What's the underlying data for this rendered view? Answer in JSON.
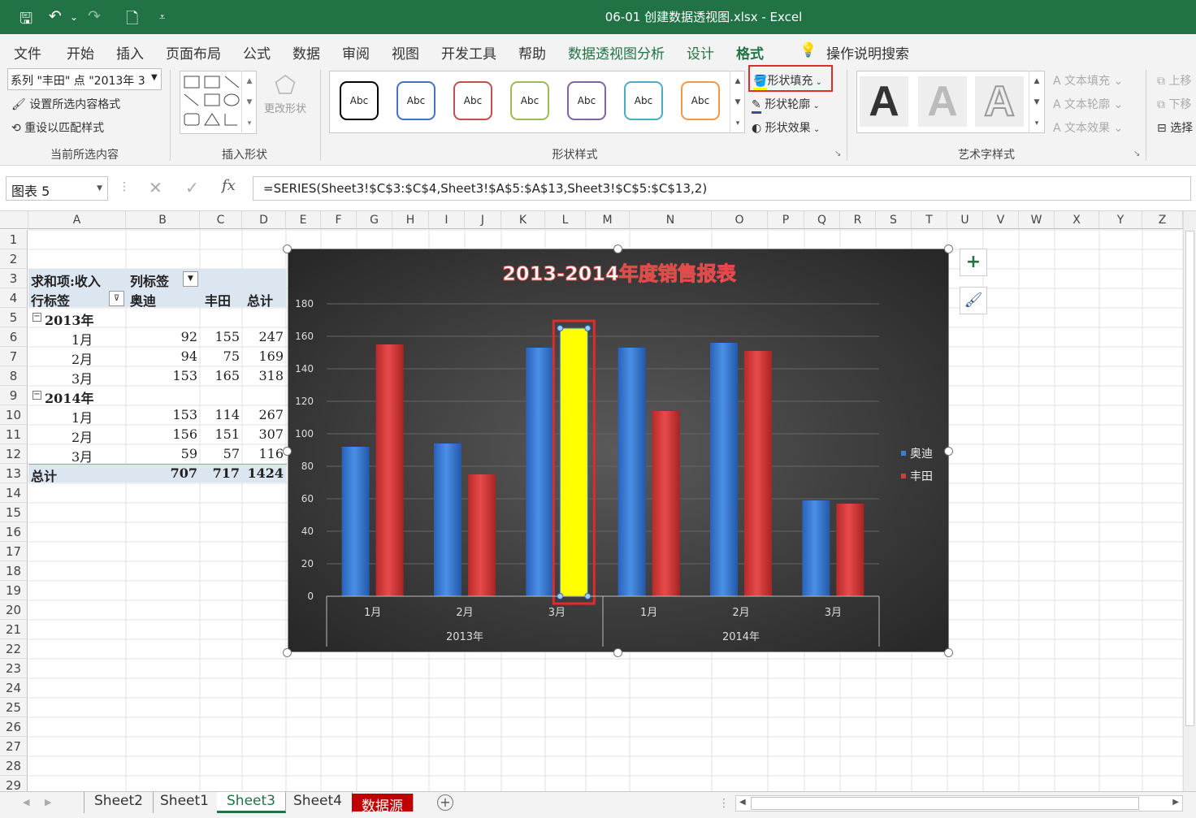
{
  "titlebar": {
    "title": "06-01 创建数据透视图.xlsx  -  Excel",
    "save_icon": "save-icon",
    "undo_icon": "undo-icon",
    "redo_icon": "redo-icon"
  },
  "tabs": [
    "文件",
    "开始",
    "插入",
    "页面布局",
    "公式",
    "数据",
    "审阅",
    "视图",
    "开发工具",
    "帮助",
    "数据透视图分析",
    "设计",
    "格式"
  ],
  "tell_me": "操作说明搜索",
  "ribbon": {
    "current_selection": {
      "dropdown": "系列 \"丰田\" 点 \"2013年 3",
      "format_btn": "设置所选内容格式",
      "reset_btn": "重设以匹配样式",
      "label": "当前所选内容"
    },
    "insert_shapes": {
      "change_shape": "更改形状",
      "label": "插入形状"
    },
    "shape_styles": {
      "samples": [
        "Abc",
        "Abc",
        "Abc",
        "Abc",
        "Abc",
        "Abc",
        "Abc"
      ],
      "colors": [
        "#000000",
        "#4472c4",
        "#c0504d",
        "#9bbb59",
        "#8064a2",
        "#4bacc6",
        "#f79646"
      ],
      "fill": "形状填充",
      "outline": "形状轮廓",
      "effect": "形状效果",
      "label": "形状样式"
    },
    "wordart": {
      "letters": [
        "A",
        "A",
        "A"
      ],
      "text_fill": "文本填充",
      "text_outline": "文本轮廓",
      "text_effect": "文本效果",
      "label": "艺术字样式"
    },
    "arrange": {
      "forward": "上移",
      "backward": "下移",
      "selection": "选择"
    }
  },
  "formula_bar": {
    "name_box": "图表 5",
    "formula": "=SERIES(Sheet3!$C$3:$C$4,Sheet3!$A$5:$A$13,Sheet3!$C$5:$C$13,2)"
  },
  "columns": [
    "A",
    "B",
    "C",
    "D",
    "E",
    "F",
    "G",
    "H",
    "I",
    "J",
    "K",
    "L",
    "M",
    "N",
    "O",
    "P",
    "Q",
    "R",
    "S",
    "T",
    "U",
    "V",
    "W",
    "X",
    "Y",
    "Z"
  ],
  "rows": [
    "1",
    "2",
    "3",
    "4",
    "5",
    "6",
    "7",
    "8",
    "9",
    "10",
    "11",
    "12",
    "13",
    "14",
    "15",
    "16",
    "17",
    "18",
    "19",
    "20",
    "21",
    "22",
    "23",
    "24",
    "25",
    "26",
    "27",
    "28",
    "29"
  ],
  "pivot": {
    "r3": [
      "求和项:收入",
      "列标签"
    ],
    "r4": [
      "行标签",
      "奥迪",
      "丰田",
      "总计"
    ],
    "y2013": "2013年",
    "y2014": "2014年",
    "rows2013": [
      [
        "1月",
        "92",
        "155",
        "247"
      ],
      [
        "2月",
        "94",
        "75",
        "169"
      ],
      [
        "3月",
        "153",
        "165",
        "318"
      ]
    ],
    "rows2014": [
      [
        "1月",
        "153",
        "114",
        "267"
      ],
      [
        "2月",
        "156",
        "151",
        "307"
      ],
      [
        "3月",
        "59",
        "57",
        "116"
      ]
    ],
    "total": [
      "总计",
      "707",
      "717",
      "1424"
    ]
  },
  "chart_data": {
    "type": "bar",
    "title": "2013-2014年度销售报表",
    "categories": [
      "1月",
      "2月",
      "3月",
      "1月",
      "2月",
      "3月"
    ],
    "groups": [
      "2013年",
      "2014年"
    ],
    "series": [
      {
        "name": "奥迪",
        "values": [
          92,
          94,
          153,
          153,
          156,
          59
        ],
        "color": "#3b7dd8"
      },
      {
        "name": "丰田",
        "values": [
          155,
          75,
          165,
          114,
          151,
          57
        ],
        "color": "#d93a3a"
      }
    ],
    "selected_point": {
      "series": "丰田",
      "category": "3月",
      "group": "2013年",
      "fill": "#ffff00"
    },
    "ylim": [
      0,
      180
    ],
    "yticks": [
      0,
      20,
      40,
      60,
      80,
      100,
      120,
      140,
      160,
      180
    ],
    "legend": "right"
  },
  "sheets": [
    "Sheet2",
    "Sheet1",
    "Sheet3",
    "Sheet4",
    "数据源"
  ],
  "active_sheet": "Sheet3"
}
